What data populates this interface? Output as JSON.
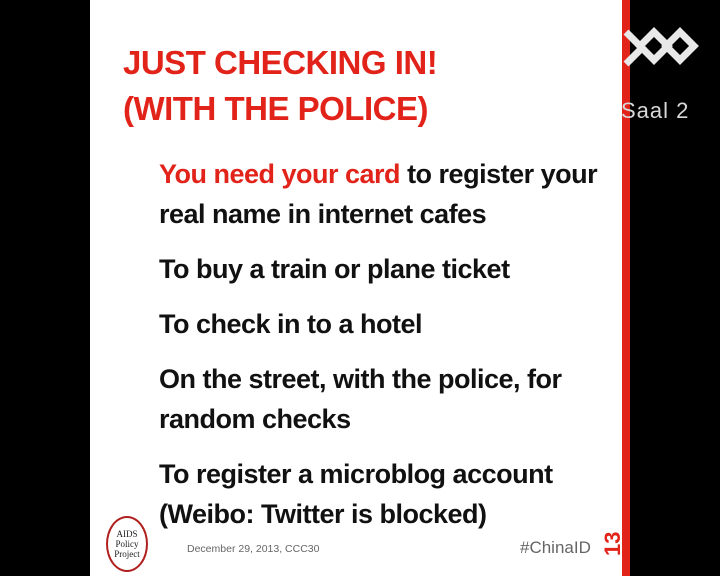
{
  "title": {
    "line1": "JUST CHECKING IN!",
    "line2": "(WITH THE POLICE)"
  },
  "bullets": {
    "item1_highlight": "You need your card",
    "item1_rest": " to register your real name in internet cafes",
    "item2": "To buy a train or plane ticket",
    "item3": "To check in to a hotel",
    "item4": "On the street, with the police, for random checks",
    "item5": "To register a microblog account (Weibo: Twitter is blocked)"
  },
  "logo": {
    "line1": "AIDS",
    "line2": "Policy",
    "line3": "Project"
  },
  "footer": {
    "date": "December 29, 2013, CCC30",
    "hashtag": "#ChinaID",
    "page_number": "13"
  },
  "overlay": {
    "room_label": "Saal 2"
  },
  "colors": {
    "accent": "#e2231a",
    "background": "#000000",
    "slide": "#ffffff"
  }
}
